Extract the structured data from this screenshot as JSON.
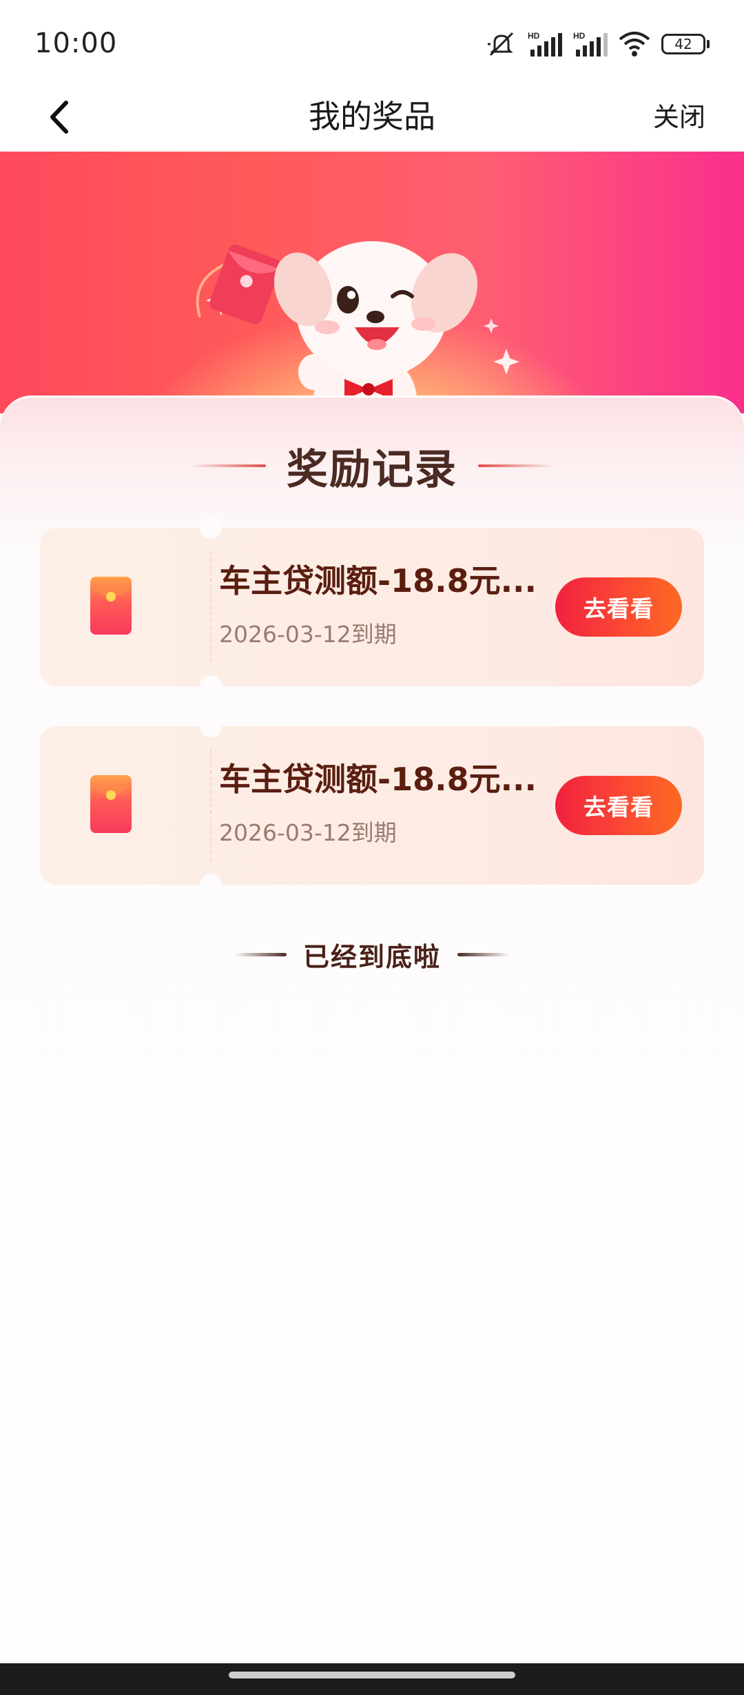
{
  "status_bar": {
    "time": "10:00",
    "battery_level": "42",
    "icons": [
      "mute-icon",
      "signal-hd-icon",
      "signal-hd-icon",
      "wifi-icon",
      "battery-icon"
    ]
  },
  "nav": {
    "back_icon": "chevron-left-icon",
    "title": "我的奖品",
    "close_label": "关闭"
  },
  "banner": {
    "illustration": "mascot-dog-with-red-envelope"
  },
  "section": {
    "title": "奖励记录"
  },
  "rewards": [
    {
      "icon": "red-envelope-icon",
      "name": "车主贷测额-18.8元...",
      "expiry": "2026-03-12到期",
      "action_label": "去看看"
    },
    {
      "icon": "red-envelope-icon",
      "name": "车主贷测额-18.8元...",
      "expiry": "2026-03-12到期",
      "action_label": "去看看"
    }
  ],
  "footer": {
    "end_text": "已经到底啦"
  },
  "colors": {
    "banner_gradient": [
      "#ff4a5c",
      "#fa2f8c"
    ],
    "button_gradient": [
      "#f2213e",
      "#fc6a24"
    ],
    "title_text": "#4a2a22",
    "reward_name": "#5a1e10",
    "expiry_text": "#9a7a70"
  }
}
